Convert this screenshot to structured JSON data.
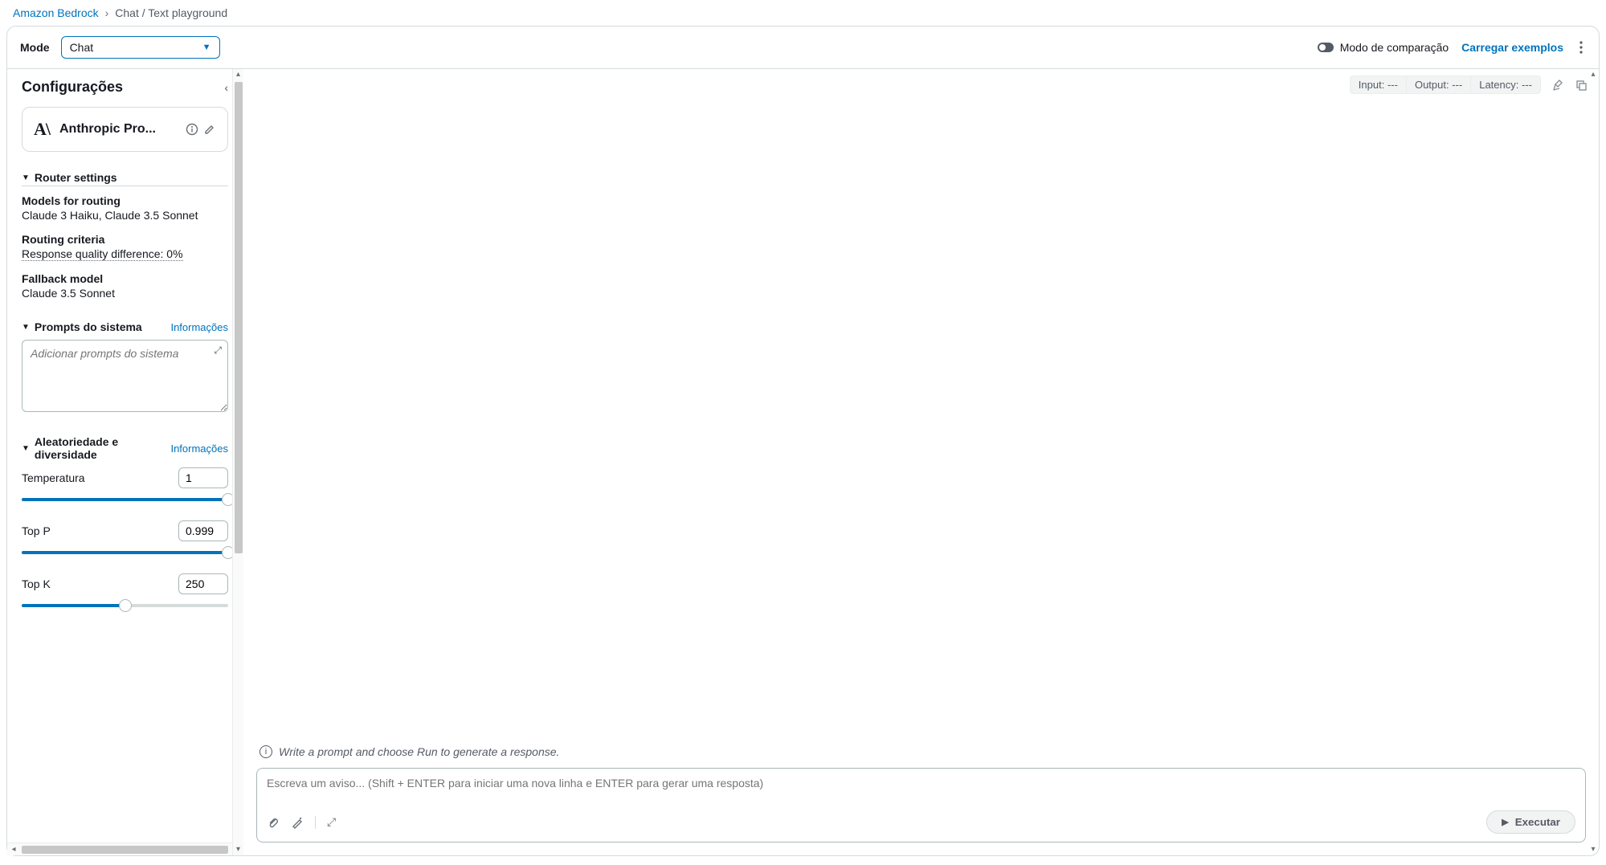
{
  "breadcrumb": {
    "root": "Amazon Bedrock",
    "current": "Chat / Text playground"
  },
  "topbar": {
    "mode_label": "Mode",
    "mode_value": "Chat",
    "compare_toggle_label": "Modo de comparação",
    "load_examples": "Carregar exemplos"
  },
  "sidebar": {
    "title": "Configurações",
    "model_name": "Anthropic Pro...",
    "router": {
      "heading": "Router settings",
      "models_label": "Models for routing",
      "models_value": "Claude 3 Haiku, Claude 3.5 Sonnet",
      "criteria_label": "Routing criteria",
      "criteria_value": "Response quality difference: 0%",
      "fallback_label": "Fallback model",
      "fallback_value": "Claude 3.5 Sonnet"
    },
    "system_prompts": {
      "heading": "Prompts do sistema",
      "info": "Informações",
      "placeholder": "Adicionar prompts do sistema"
    },
    "randomness": {
      "heading": "Aleatoriedade e diversidade",
      "info": "Informações",
      "temperature_label": "Temperatura",
      "temperature_value": "1",
      "top_p_label": "Top P",
      "top_p_value": "0.999",
      "top_k_label": "Top K",
      "top_k_value": "250"
    }
  },
  "metrics": {
    "input_label": "Input:",
    "input_value": "---",
    "output_label": "Output:",
    "output_value": "---",
    "latency_label": "Latency:",
    "latency_value": "---"
  },
  "main": {
    "hint": "Write a prompt and choose Run to generate a response.",
    "prompt_placeholder": "Escreva um aviso... (Shift + ENTER para iniciar uma nova linha e ENTER para gerar uma resposta)",
    "run_label": "Executar"
  }
}
